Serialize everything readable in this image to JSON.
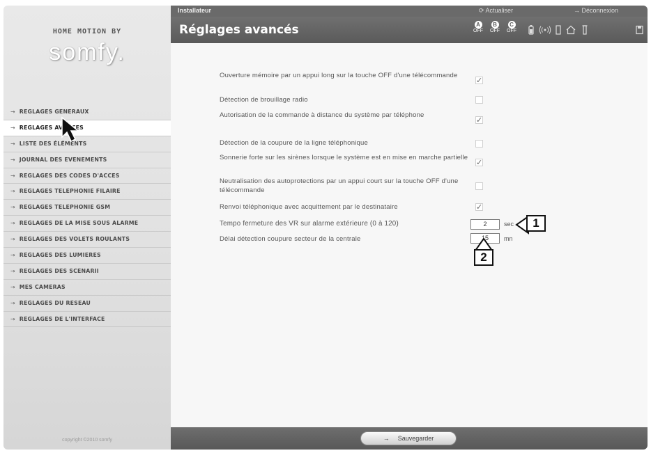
{
  "brand": {
    "line1": "HOME MOTION BY",
    "logo": "somfy."
  },
  "nav": {
    "items": [
      {
        "label": "REGLAGES GENERAUX"
      },
      {
        "label": "REGLAGES AVANCES"
      },
      {
        "label": "LISTE DES ÉLÉMENTS"
      },
      {
        "label": "JOURNAL DES EVENEMENTS"
      },
      {
        "label": "REGLAGES DES CODES D'ACCES"
      },
      {
        "label": "REGLAGES TELEPHONIE FILAIRE"
      },
      {
        "label": "REGLAGES TELEPHONIE GSM"
      },
      {
        "label": "REGLAGES DE LA MISE SOUS ALARME"
      },
      {
        "label": "REGLAGES DES VOLETS ROULANTS"
      },
      {
        "label": "REGLAGES DES LUMIERES"
      },
      {
        "label": "REGLAGES DES SCENARII"
      },
      {
        "label": "MES CAMERAS"
      },
      {
        "label": "REGLAGES DU RESEAU"
      },
      {
        "label": "REGLAGES DE L'INTERFACE"
      }
    ],
    "active": "REGLAGES AVANCES",
    "arrow": "→"
  },
  "copyright": "copyright ©2010 somfy",
  "topbar": {
    "user": "Installateur",
    "refresh": "⟳ Actualiser",
    "logout": "→ Déconnexion"
  },
  "title": "Réglages avancés",
  "zones": [
    {
      "letter": "A",
      "state": "OFF"
    },
    {
      "letter": "B",
      "state": "OFF"
    },
    {
      "letter": "C",
      "state": "OFF"
    }
  ],
  "settings": [
    {
      "label": "Ouverture mémoire par un appui long sur la touche OFF d'une télécommande",
      "checked": true
    },
    {
      "label": "Détection de brouillage radio",
      "checked": false
    },
    {
      "label": "Autorisation de la commande à distance du système par téléphone",
      "checked": true
    },
    {
      "label": "Détection de la coupure de la ligne téléphonique",
      "checked": false
    },
    {
      "label": "Sonnerie forte sur les sirènes lorsque le système est en mise en marche partielle",
      "checked": true
    },
    {
      "label": "Neutralisation des autoprotections par un appui court sur la touche OFF d'une télécommande",
      "checked": false
    },
    {
      "label": "Renvoi téléphonique avec acquittement par le destinataire",
      "checked": true
    }
  ],
  "numeric": [
    {
      "label": "Tempo fermeture des VR sur alarme extérieure (0 à 120)",
      "value": "2",
      "unit": "sec"
    },
    {
      "label": "Délai détection coupure secteur de la centrale",
      "value": "15",
      "unit": "mn"
    }
  ],
  "callouts": [
    "1",
    "2"
  ],
  "save_label": "Sauvegarder",
  "save_arrow": "→"
}
